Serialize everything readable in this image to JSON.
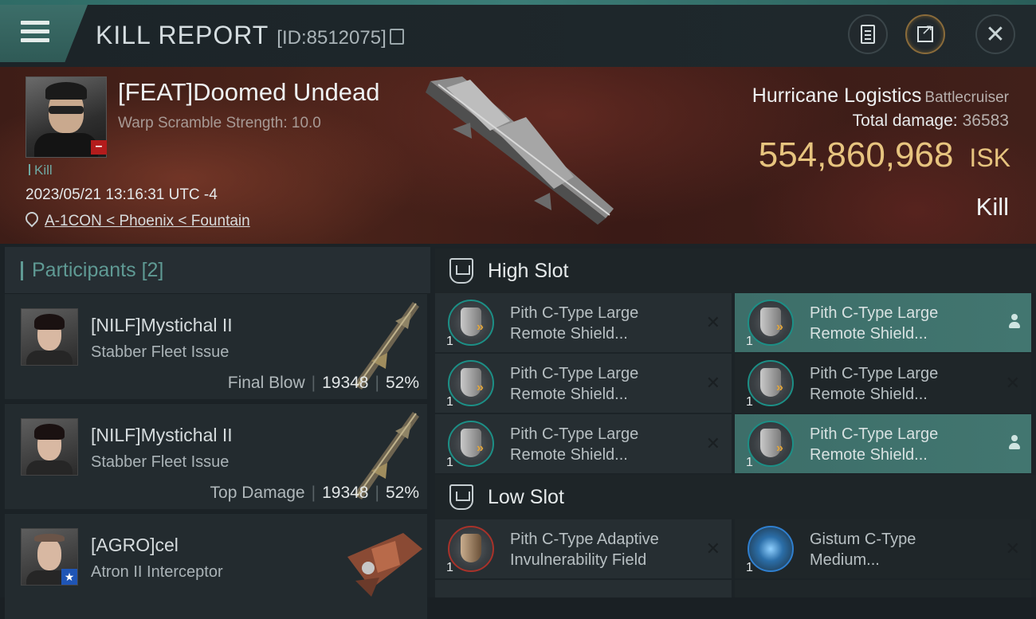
{
  "header": {
    "title": "KILL REPORT",
    "report_id": "[ID:8512075]"
  },
  "victim": {
    "name": "[FEAT]Doomed Undead",
    "warp_scramble": "Warp Scramble Strength: 10.0",
    "tag": "Kill",
    "timestamp": "2023/05/21 13:16:31 UTC -4",
    "location": "A-1CON < Phoenix < Fountain",
    "ship_name": "Hurricane Logistics",
    "ship_class": "Battlecruiser",
    "total_damage_label": "Total damage:",
    "total_damage": "36583",
    "isk_value": "554,860,968",
    "isk_unit": "ISK",
    "result": "Kill"
  },
  "participants": {
    "label": "Participants",
    "count": "[2]",
    "rows": [
      {
        "name": "[NILF]Mystichal II",
        "ship": "Stabber Fleet Issue",
        "role": "Final Blow",
        "damage": "19348",
        "percent": "52%"
      },
      {
        "name": "[NILF]Mystichal II",
        "ship": "Stabber Fleet Issue",
        "role": "Top Damage",
        "damage": "19348",
        "percent": "52%"
      },
      {
        "name": "[AGRO]cel",
        "ship": "Atron II Interceptor"
      }
    ]
  },
  "fitting": {
    "high_slot_label": "High Slot",
    "low_slot_label": "Low Slot",
    "high": [
      {
        "line1": "Pith C-Type Large",
        "line2": "Remote Shield...",
        "qty": "1"
      },
      {
        "line1": "Pith C-Type Large",
        "line2": "Remote Shield...",
        "qty": "1"
      },
      {
        "line1": "Pith C-Type Large",
        "line2": "Remote Shield...",
        "qty": "1"
      },
      {
        "line1": "Pith C-Type Large",
        "line2": "Remote Shield...",
        "qty": "1"
      },
      {
        "line1": "Pith C-Type Large",
        "line2": "Remote Shield...",
        "qty": "1"
      },
      {
        "line1": "Pith C-Type Large",
        "line2": "Remote Shield...",
        "qty": "1"
      }
    ],
    "low": [
      {
        "line1": "Pith C-Type Adaptive",
        "line2": "Invulnerability Field",
        "qty": "1"
      },
      {
        "line1": "Gistum C-Type",
        "line2": "Medium...",
        "qty": "1"
      }
    ]
  },
  "icons": {
    "menu": "menu-icon",
    "copy": "copy-icon",
    "clipboard": "clipboard-icon",
    "share": "share-icon",
    "close": "close-icon",
    "location": "location-pin-icon",
    "slot": "slot-icon",
    "dropped": "x-icon",
    "pilot": "user-icon"
  },
  "colors": {
    "accent": "#3d6e69",
    "isk": "#e7c47f",
    "loss_badge": "#b31c1c",
    "banner": "#4a231a"
  }
}
